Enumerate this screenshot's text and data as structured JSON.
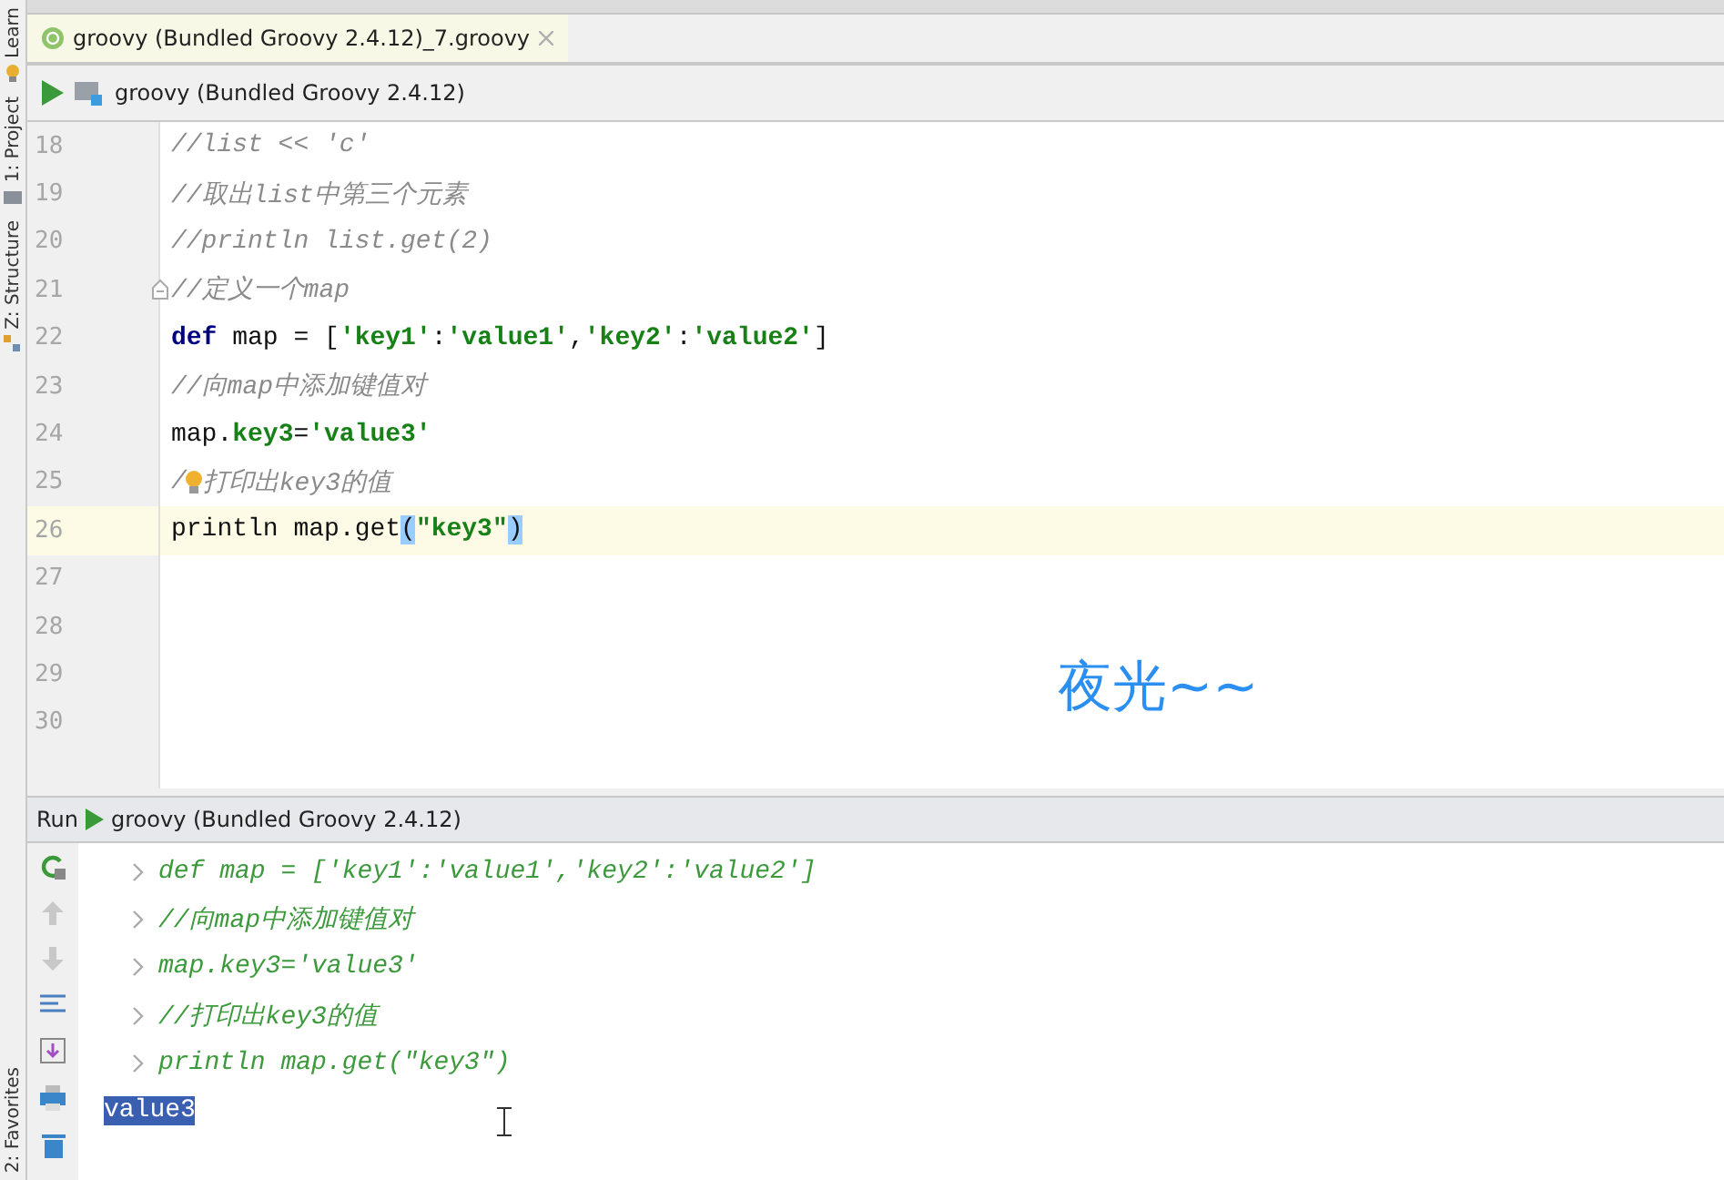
{
  "side_tabs_top": [
    {
      "label": "Learn"
    },
    {
      "label": "1: Project"
    },
    {
      "label": "Z: Structure"
    }
  ],
  "side_tabs_bottom": [
    {
      "label": "2: Favorites"
    }
  ],
  "editor_tabs": [
    {
      "label": "groovy (Bundled Groovy 2.4.12)_7.groovy",
      "selected": true
    }
  ],
  "run_config": {
    "label": "groovy (Bundled Groovy 2.4.12)"
  },
  "editor": {
    "lines": [
      {
        "number": "18",
        "current": false,
        "fold": false,
        "tokens": [
          {
            "kind": "comment",
            "text": "//list << 'c'"
          }
        ]
      },
      {
        "number": "19",
        "current": false,
        "fold": false,
        "tokens": [
          {
            "kind": "comment",
            "text": "//取出list中第三个元素"
          }
        ]
      },
      {
        "number": "20",
        "current": false,
        "fold": false,
        "tokens": [
          {
            "kind": "comment",
            "text": "//println list.get(2)"
          }
        ]
      },
      {
        "number": "21",
        "current": false,
        "fold": true,
        "tokens": [
          {
            "kind": "comment",
            "text": "//定义一个map"
          }
        ]
      },
      {
        "number": "22",
        "current": false,
        "fold": false,
        "tokens": [
          {
            "kind": "keyword",
            "text": "def"
          },
          {
            "kind": "plain",
            "text": " map = ["
          },
          {
            "kind": "string",
            "text": "'key1'"
          },
          {
            "kind": "plain",
            "text": ":"
          },
          {
            "kind": "string",
            "text": "'value1'"
          },
          {
            "kind": "plain",
            "text": ","
          },
          {
            "kind": "string",
            "text": "'key2'"
          },
          {
            "kind": "plain",
            "text": ":"
          },
          {
            "kind": "string",
            "text": "'value2'"
          },
          {
            "kind": "plain",
            "text": "]"
          }
        ]
      },
      {
        "number": "23",
        "current": false,
        "fold": false,
        "tokens": [
          {
            "kind": "comment",
            "text": "//向map中添加键值对"
          }
        ]
      },
      {
        "number": "24",
        "current": false,
        "fold": false,
        "tokens": [
          {
            "kind": "plain",
            "text": "map."
          },
          {
            "kind": "string",
            "text": "key3"
          },
          {
            "kind": "plain",
            "text": "="
          },
          {
            "kind": "string",
            "text": "'value3'"
          }
        ]
      },
      {
        "number": "25",
        "current": false,
        "fold": false,
        "tokens": [
          {
            "kind": "comment",
            "text": "/"
          },
          {
            "kind": "bulb"
          },
          {
            "kind": "comment",
            "text": "打印出key3的值"
          }
        ]
      },
      {
        "number": "26",
        "current": true,
        "fold": false,
        "tokens": [
          {
            "kind": "plain",
            "text": "println map.get"
          },
          {
            "kind": "match",
            "text": "("
          },
          {
            "kind": "string",
            "text": "\"key3\""
          },
          {
            "kind": "match",
            "text": ")"
          }
        ]
      },
      {
        "number": "27",
        "current": false,
        "fold": false
      },
      {
        "number": "28",
        "current": false,
        "fold": false
      },
      {
        "number": "29",
        "current": false,
        "fold": false
      },
      {
        "number": "30",
        "current": false,
        "fold": false
      }
    ]
  },
  "overlay_note": "夜光~~",
  "run_panel": {
    "title": "Run",
    "config": "groovy (Bundled Groovy 2.4.12)",
    "console": [
      {
        "kind": "input",
        "text": "def map = ['key1':'value1','key2':'value2']"
      },
      {
        "kind": "input",
        "text": "//向map中添加键值对"
      },
      {
        "kind": "input",
        "text": "map.key3='value3'"
      },
      {
        "kind": "input",
        "text": "//打印出key3的值"
      },
      {
        "kind": "input",
        "text": "println map.get(\"key3\")"
      },
      {
        "kind": "output",
        "text": "value3",
        "selected": true
      }
    ]
  }
}
